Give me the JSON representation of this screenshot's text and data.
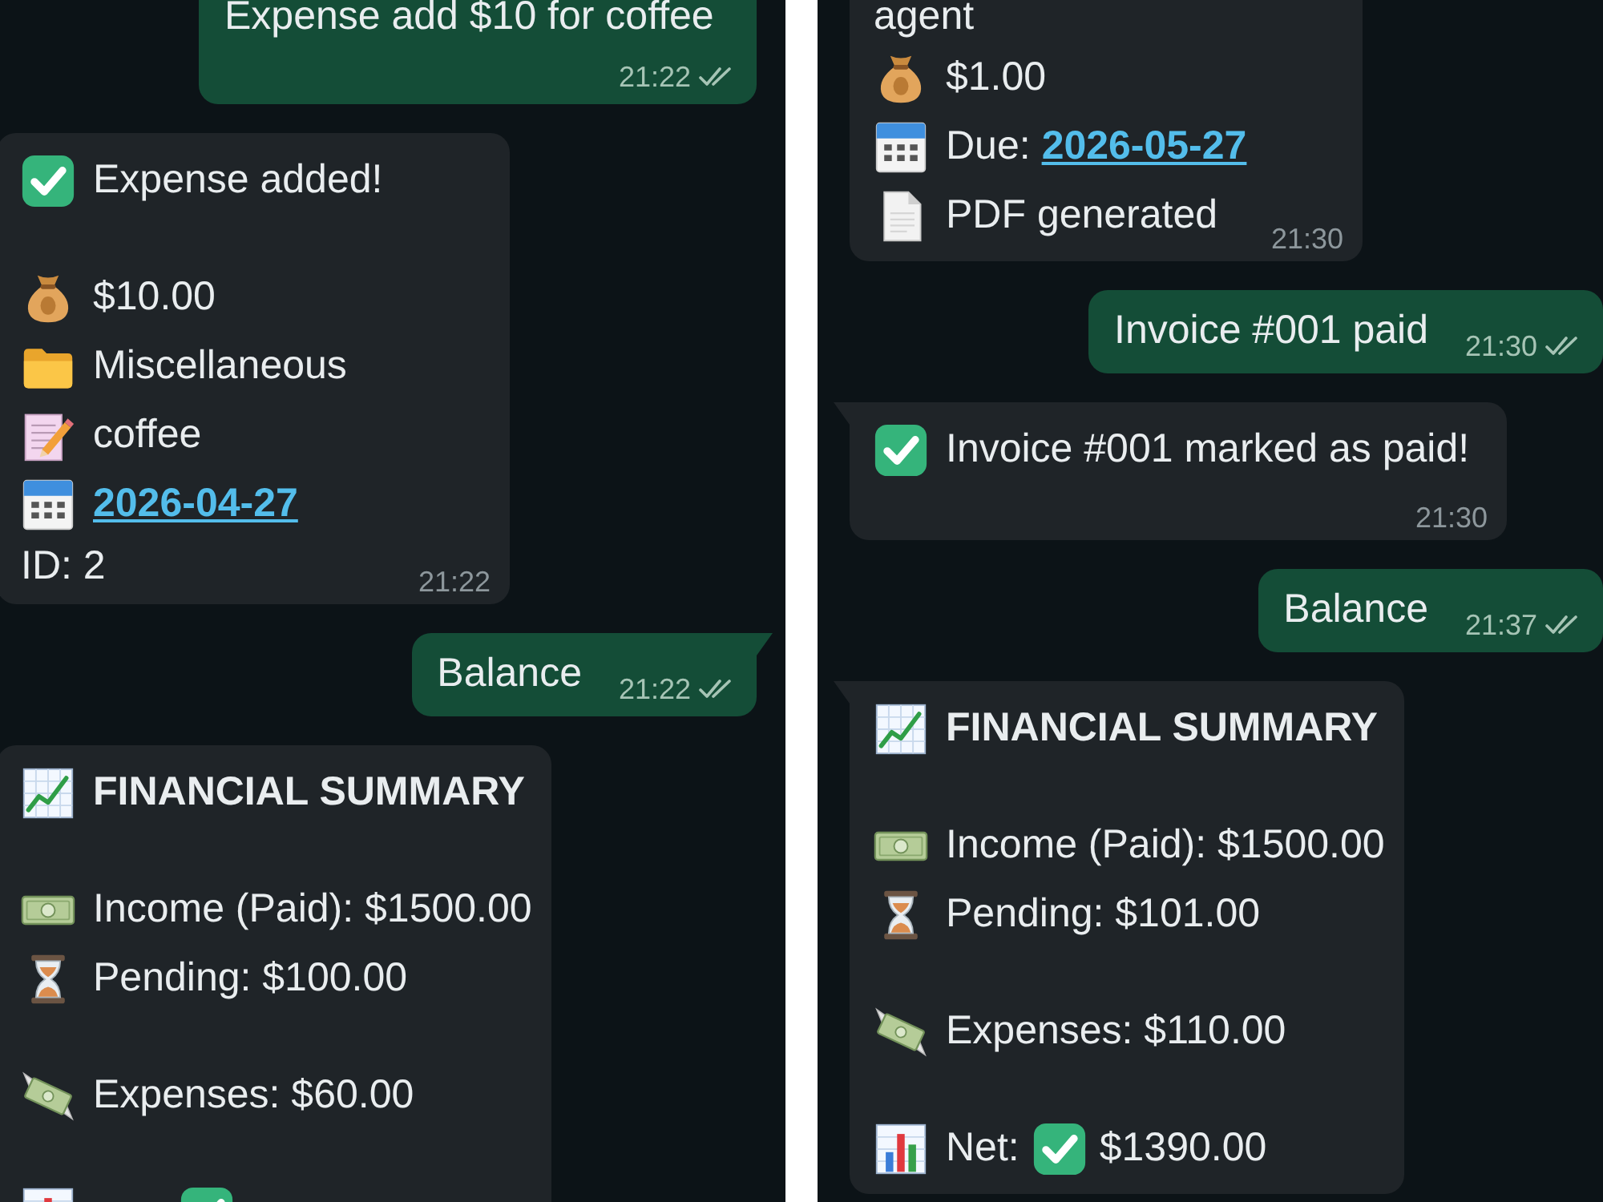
{
  "panels": [
    {
      "messages": [
        {
          "kind": "outgoing",
          "lines": [
            {
              "kind": "plain",
              "text": "Expense add $10 for coffee"
            }
          ],
          "time": "21:22",
          "read": false
        },
        {
          "kind": "incoming",
          "tail": false,
          "lines": [
            {
              "kind": "success",
              "text": "Expense added!"
            },
            {
              "kind": "blank"
            },
            {
              "kind": "amount",
              "text": "$10.00"
            },
            {
              "kind": "category",
              "text": "Miscellaneous"
            },
            {
              "kind": "note",
              "text": "coffee"
            },
            {
              "kind": "date",
              "link": "2026-04-27"
            },
            {
              "kind": "plain",
              "text": "ID: 2"
            }
          ],
          "time": "21:22"
        },
        {
          "kind": "outgoing",
          "tail": true,
          "lines": [
            {
              "kind": "plain",
              "text": "Balance"
            }
          ],
          "time": "21:22",
          "read": false
        },
        {
          "kind": "incoming",
          "tail": false,
          "lines": [
            {
              "kind": "title",
              "text": "FINANCIAL SUMMARY"
            },
            {
              "kind": "blank"
            },
            {
              "kind": "income",
              "text": "Income (Paid): $1500.00"
            },
            {
              "kind": "pending",
              "text": "Pending: $100.00"
            },
            {
              "kind": "blank"
            },
            {
              "kind": "expenses",
              "text": "Expenses: $60.00"
            },
            {
              "kind": "blank"
            },
            {
              "kind": "net"
            }
          ]
        }
      ]
    },
    {
      "messages": [
        {
          "kind": "incoming",
          "lines": [
            {
              "kind": "plain",
              "text": "agent"
            },
            {
              "kind": "amount",
              "text": "$1.00"
            },
            {
              "kind": "date",
              "label": "Due:",
              "link": "2026-05-27"
            },
            {
              "kind": "document",
              "text": "PDF generated"
            }
          ],
          "time": "21:30"
        },
        {
          "kind": "outgoing",
          "tail": false,
          "lines": [
            {
              "kind": "plain",
              "text": "Invoice #001 paid"
            }
          ],
          "time": "21:30",
          "read": false
        },
        {
          "kind": "incoming",
          "tail": true,
          "lines": [
            {
              "kind": "success",
              "text": "Invoice #001 marked as paid!"
            }
          ],
          "time": "21:30"
        },
        {
          "kind": "outgoing",
          "tail": false,
          "lines": [
            {
              "kind": "plain",
              "text": "Balance"
            }
          ],
          "time": "21:37",
          "read": false
        },
        {
          "kind": "incoming",
          "tail": true,
          "lines": [
            {
              "kind": "title",
              "text": "FINANCIAL SUMMARY"
            },
            {
              "kind": "blank"
            },
            {
              "kind": "income",
              "text": "Income (Paid): $1500.00"
            },
            {
              "kind": "pending",
              "text": "Pending: $101.00"
            },
            {
              "kind": "blank"
            },
            {
              "kind": "expenses",
              "text": "Expenses: $110.00"
            },
            {
              "kind": "blank"
            },
            {
              "kind": "net",
              "label": "Net:",
              "text": "$1390.00"
            }
          ]
        }
      ]
    }
  ]
}
